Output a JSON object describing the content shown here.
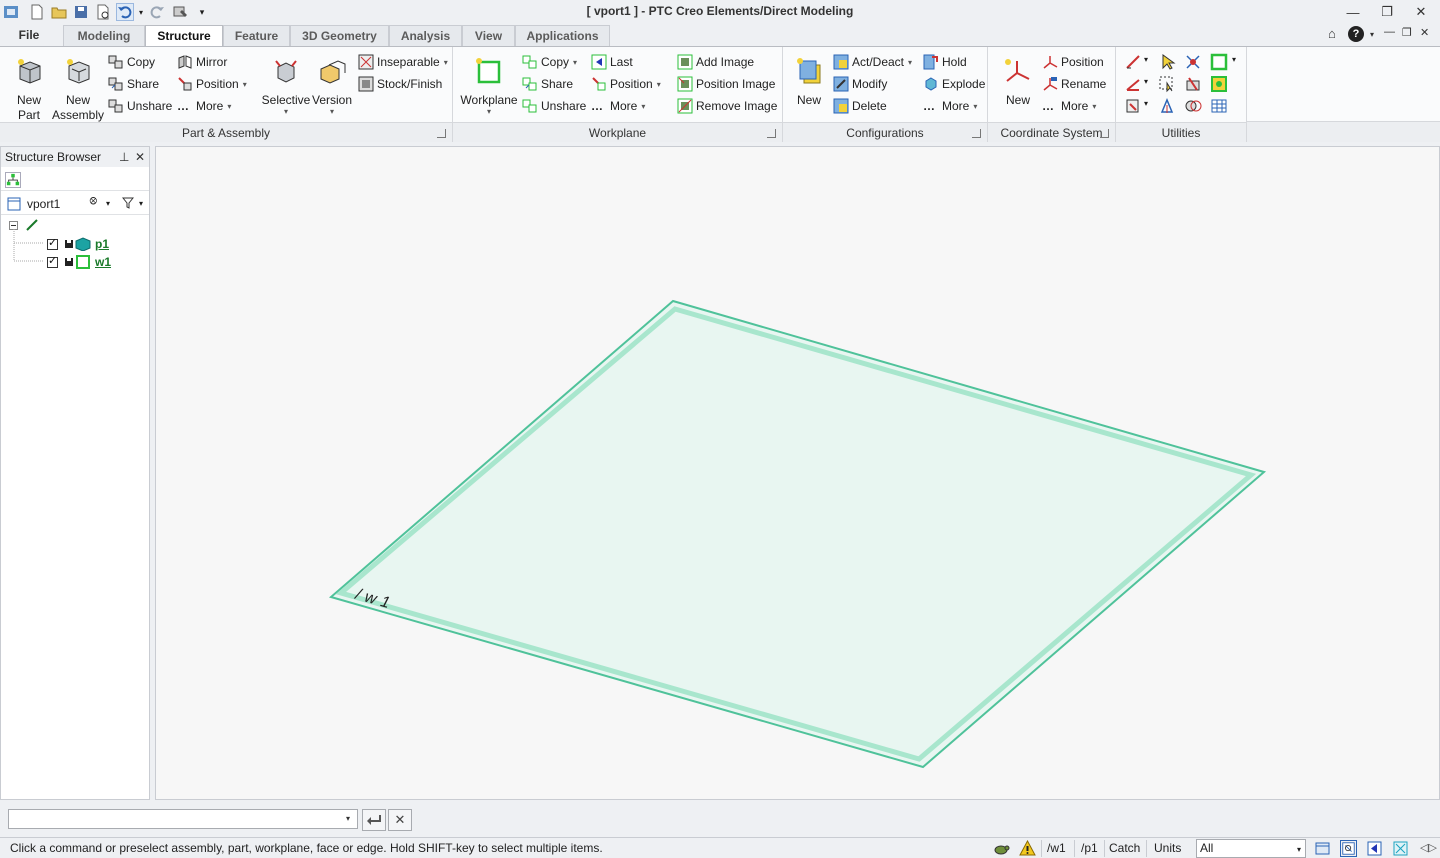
{
  "window": {
    "title": "[ vport1 ] - PTC Creo Elements/Direct Modeling"
  },
  "tabs": {
    "file": "File",
    "items": [
      "Modeling",
      "Structure",
      "Feature",
      "3D Geometry",
      "Analysis",
      "View",
      "Applications"
    ],
    "active": "Structure"
  },
  "ribbon": {
    "part_assembly": {
      "label": "Part & Assembly",
      "new_part": "New Part",
      "new_part_l1": "New",
      "new_part_l2": "Part",
      "new_assembly_l1": "New",
      "new_assembly_l2": "Assembly",
      "copy": "Copy",
      "share": "Share",
      "unshare": "Unshare",
      "mirror": "Mirror",
      "position": "Position",
      "more": "More",
      "selective": "Selective",
      "version": "Version",
      "inseparable": "Inseparable",
      "stock_finish": "Stock/Finish"
    },
    "workplane": {
      "label": "Workplane",
      "workplane": "Workplane",
      "copy": "Copy",
      "share": "Share",
      "unshare": "Unshare",
      "last": "Last",
      "position": "Position",
      "more": "More",
      "add_image": "Add Image",
      "position_image": "Position Image",
      "remove_image": "Remove Image"
    },
    "configurations": {
      "label": "Configurations",
      "new": "New",
      "act_deact": "Act/Deact",
      "modify": "Modify",
      "delete": "Delete",
      "hold": "Hold",
      "explode": "Explode",
      "more": "More"
    },
    "coordinate_system": {
      "label": "Coordinate System",
      "new": "New",
      "position": "Position",
      "rename": "Rename",
      "more": "More"
    },
    "utilities": {
      "label": "Utilities"
    }
  },
  "structure_browser": {
    "title": "Structure Browser",
    "root": "vport1",
    "items": [
      {
        "name": "p1"
      },
      {
        "name": "w1"
      }
    ]
  },
  "viewport": {
    "workplane_label": "/w1",
    "plane_fill": "#e8f6f1",
    "plane_edge": "#4fc29a"
  },
  "status": {
    "message": "Click a command or preselect assembly, part, workplane, face or edge. Hold SHIFT-key to select multiple items.",
    "active_wp": "/w1",
    "active_part": "/p1",
    "catch": "Catch",
    "units": "Units",
    "filter": "All"
  },
  "colors": {
    "accent": "#1a7a2a",
    "ribbon_bg": "#fafbfc",
    "chrome_bg": "#eef0f3"
  }
}
